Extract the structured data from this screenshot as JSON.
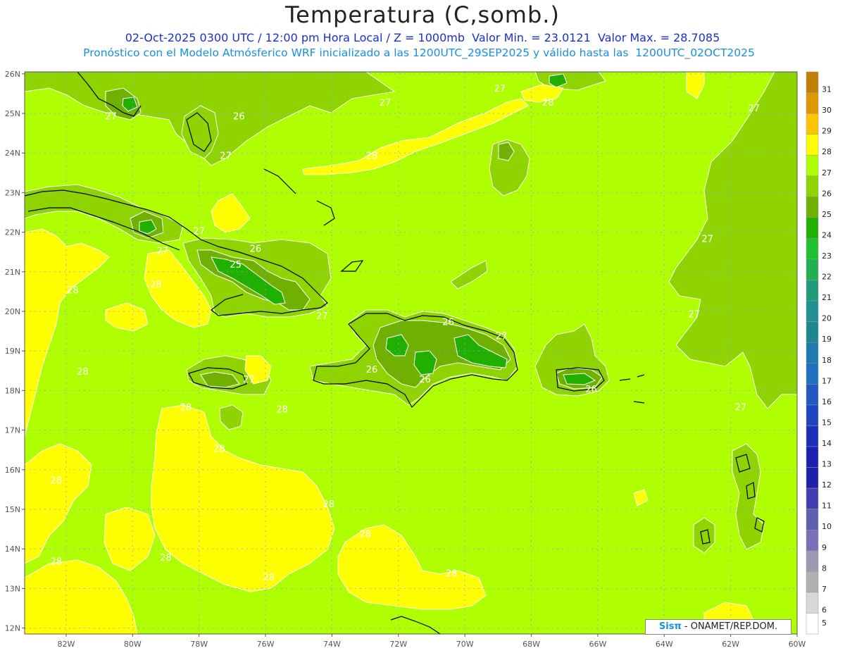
{
  "title": "Temperatura (C,somb.)",
  "subtitle_line1": "02-Oct-2025 0300 UTC / 12:00 pm Hora Local / Z = 1000mb  Valor Min. = 23.0121  Valor Max. = 28.7085",
  "subtitle_line2": "Pronóstico con el Modelo Atmósferico WRF inicializado a las 1200UTC_29SEP2025 y válido hasta las  1200UTC_02OCT2025",
  "credit": {
    "logo": "Sisπ",
    "text": " - ONAMET/REP.DOM."
  },
  "lat_labels": [
    "26N",
    "25N",
    "24N",
    "23N",
    "22N",
    "21N",
    "20N",
    "19N",
    "18N",
    "17N",
    "16N",
    "15N",
    "14N",
    "13N",
    "12N"
  ],
  "lon_labels": [
    "82W",
    "80W",
    "78W",
    "76W",
    "74W",
    "72W",
    "70W",
    "68W",
    "66W",
    "64W",
    "62W",
    "60W"
  ],
  "colorbar": {
    "levels": [
      "31",
      "30",
      "29",
      "28",
      "27",
      "26",
      "25",
      "24",
      "23",
      "22",
      "21",
      "20",
      "19",
      "18",
      "17",
      "16",
      "15",
      "14",
      "13",
      "12",
      "11",
      "10",
      "9",
      "8",
      "7",
      "6",
      "5"
    ],
    "colors": [
      "#c08000",
      "#e09800",
      "#ffc400",
      "#ffff00",
      "#b0ff00",
      "#8fd400",
      "#6fb000",
      "#22b000",
      "#20c030",
      "#20b050",
      "#209a78",
      "#209090",
      "#1e8890",
      "#1e7ab0",
      "#2070c0",
      "#2058c0",
      "#1f45c0",
      "#1a30b8",
      "#1a20b0",
      "#2020a8",
      "#4040b0",
      "#6060b0",
      "#7b70b8",
      "#9a9ab0",
      "#b0b0b0",
      "#d8d8d8",
      "#ffffff"
    ]
  },
  "contour_labels": [
    {
      "text": "27",
      "lon": -80.65,
      "lat": 24.85
    },
    {
      "text": "26",
      "lon": -76.8,
      "lat": 24.85
    },
    {
      "text": "27",
      "lon": -77.2,
      "lat": 23.85
    },
    {
      "text": "27",
      "lon": -72.4,
      "lat": 25.2
    },
    {
      "text": "27",
      "lon": -68.95,
      "lat": 25.55
    },
    {
      "text": "28",
      "lon": -67.5,
      "lat": 25.2
    },
    {
      "text": "27",
      "lon": -61.3,
      "lat": 25.05
    },
    {
      "text": "28",
      "lon": -72.8,
      "lat": 23.85
    },
    {
      "text": "27",
      "lon": -78.0,
      "lat": 21.95
    },
    {
      "text": "26",
      "lon": -76.3,
      "lat": 21.5
    },
    {
      "text": "25",
      "lon": -76.9,
      "lat": 21.1
    },
    {
      "text": "27",
      "lon": -79.1,
      "lat": 21.45
    },
    {
      "text": "28",
      "lon": -79.3,
      "lat": 20.6
    },
    {
      "text": "28",
      "lon": -81.8,
      "lat": 20.45
    },
    {
      "text": "27",
      "lon": -62.7,
      "lat": 21.75
    },
    {
      "text": "27",
      "lon": -74.3,
      "lat": 19.8
    },
    {
      "text": "26",
      "lon": -70.5,
      "lat": 19.65
    },
    {
      "text": "27",
      "lon": -68.9,
      "lat": 19.3
    },
    {
      "text": "27",
      "lon": -63.1,
      "lat": 19.85
    },
    {
      "text": "28",
      "lon": -81.5,
      "lat": 18.4
    },
    {
      "text": "27",
      "lon": -76.5,
      "lat": 18.2
    },
    {
      "text": "26",
      "lon": -72.8,
      "lat": 18.45
    },
    {
      "text": "26",
      "lon": -71.2,
      "lat": 18.2
    },
    {
      "text": "26",
      "lon": -66.2,
      "lat": 17.95
    },
    {
      "text": "28",
      "lon": -78.4,
      "lat": 17.5
    },
    {
      "text": "28",
      "lon": -75.5,
      "lat": 17.45
    },
    {
      "text": "27",
      "lon": -61.7,
      "lat": 17.5
    },
    {
      "text": "28",
      "lon": -77.4,
      "lat": 16.45
    },
    {
      "text": "28",
      "lon": -82.3,
      "lat": 15.65
    },
    {
      "text": "28",
      "lon": -74.1,
      "lat": 15.05
    },
    {
      "text": "28",
      "lon": -73.0,
      "lat": 14.3
    },
    {
      "text": "28",
      "lon": -79.0,
      "lat": 13.7
    },
    {
      "text": "28",
      "lon": -82.3,
      "lat": 13.6
    },
    {
      "text": "28",
      "lon": -75.9,
      "lat": 13.2
    },
    {
      "text": "28",
      "lon": -70.4,
      "lat": 13.3
    }
  ]
}
